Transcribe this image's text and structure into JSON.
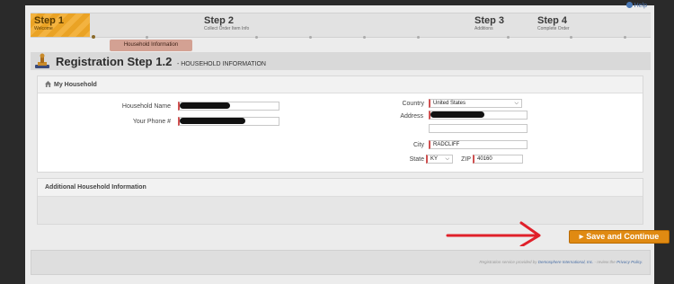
{
  "steps": [
    {
      "num": "Step 1",
      "sub": "Welcome"
    },
    {
      "num": "Step 2",
      "sub": "Collect Order Item Info"
    },
    {
      "num": "Step 3",
      "sub": "Additions"
    },
    {
      "num": "Step 4",
      "sub": "Complete Order"
    }
  ],
  "help_label": "Help",
  "current_substep": "Household Information",
  "title": {
    "main": "Registration Step 1.2",
    "sub": "- HOUSEHOLD INFORMATION"
  },
  "household_panel": {
    "heading": "My Household",
    "household_name_label": "Household Name",
    "phone_label": "Your Phone #",
    "country_label": "Country",
    "country_value": "United States",
    "address_label": "Address",
    "city_label": "City",
    "city_value": "RADCLIFF",
    "state_label": "State",
    "state_value": "KY",
    "zip_label": "ZIP",
    "zip_value": "40160"
  },
  "additional_panel": {
    "heading": "Additional Household Information"
  },
  "save_button": "Save and Continue",
  "footer": {
    "prefix": "Registration service provided by",
    "company": "Demosphere International, Inc.",
    "middle": "- review the",
    "policy": "Privacy Policy."
  },
  "colors": {
    "accent": "#e08a12",
    "step_active": "#f3b340",
    "arrow": "#e0202a"
  }
}
